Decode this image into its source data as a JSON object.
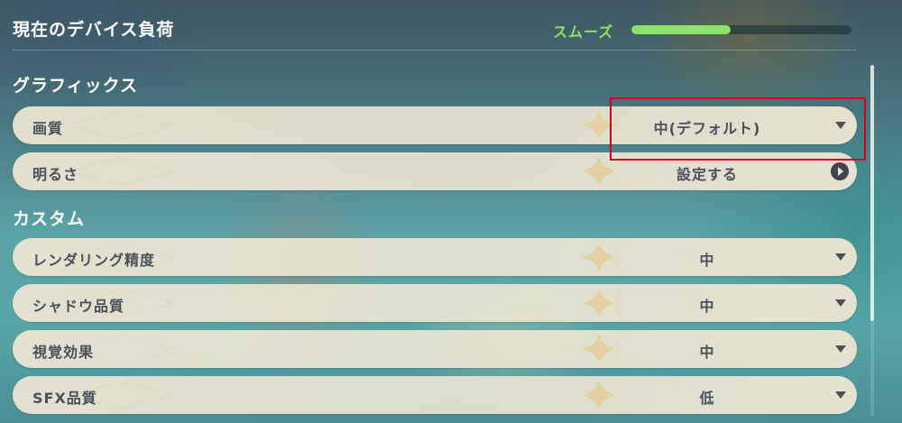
{
  "header": {
    "title": "現在のデバイス負荷",
    "load_status": "スムーズ",
    "load_level_fraction": 0.45,
    "load_color": "#8be36a"
  },
  "sections": {
    "graphics": {
      "title": "グラフィックス",
      "rows": [
        {
          "label": "画質",
          "value": "中(デフォルト)",
          "control": "chevron-down-icon"
        },
        {
          "label": "明るさ",
          "value": "設定する",
          "control": "arrow-right-circle-icon"
        }
      ]
    },
    "custom": {
      "title": "カスタム",
      "rows": [
        {
          "label": "レンダリング精度",
          "value": "中",
          "control": "chevron-down-icon"
        },
        {
          "label": "シャドウ品質",
          "value": "中",
          "control": "chevron-down-icon"
        },
        {
          "label": "視覚効果",
          "value": "中",
          "control": "chevron-down-icon"
        },
        {
          "label": "SFX品質",
          "value": "低",
          "control": "chevron-down-icon"
        }
      ]
    }
  },
  "highlight_color": "#d0021b",
  "row_text_color": "#4a4f5a"
}
